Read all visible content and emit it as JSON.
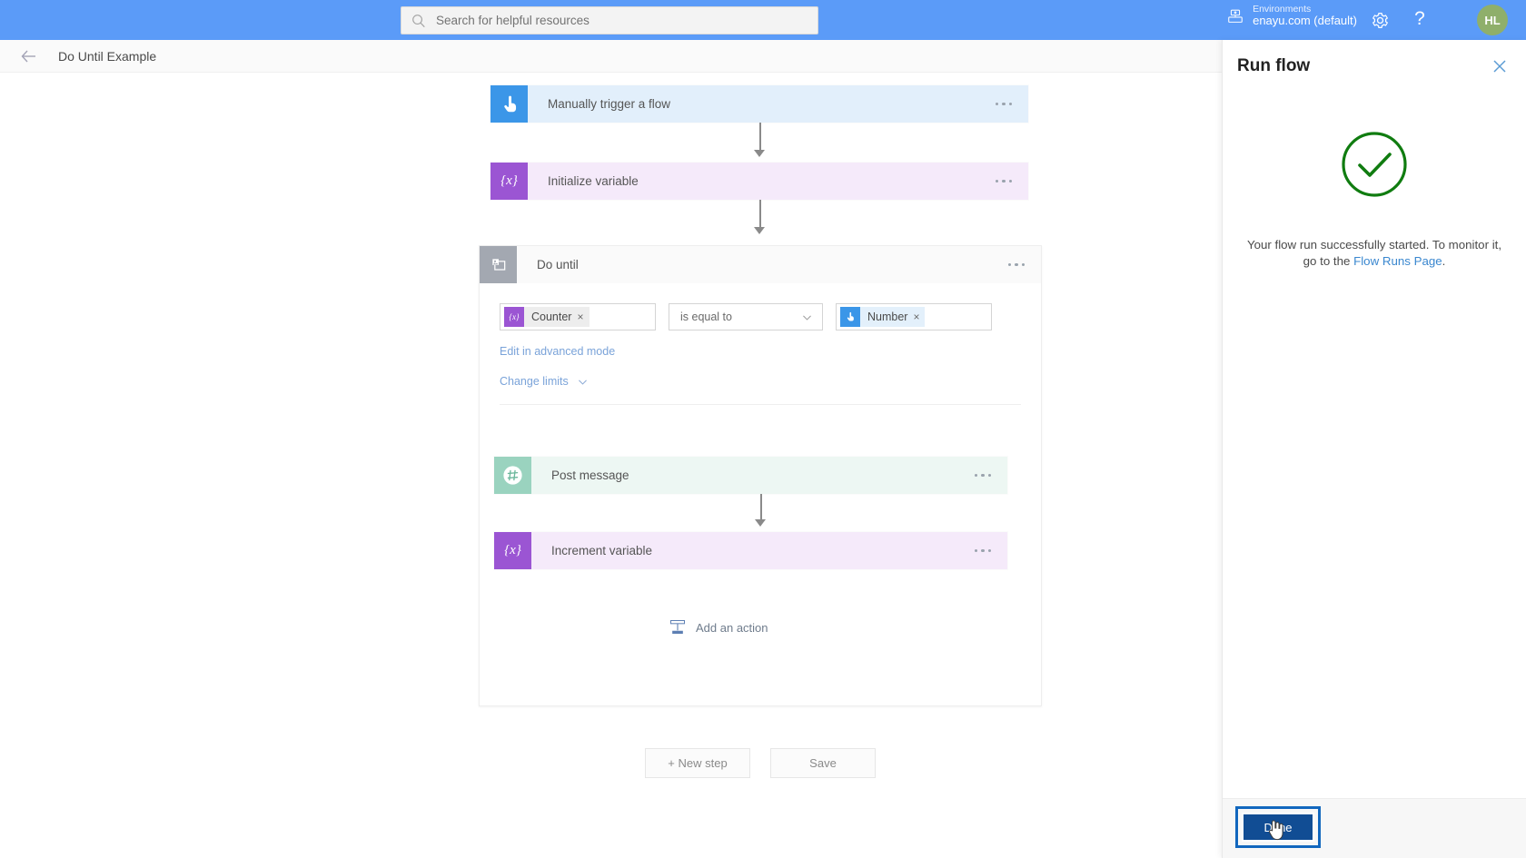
{
  "topbar": {
    "search": {
      "placeholder": "Search for helpful resources",
      "value": "",
      "icon": "search-icon"
    },
    "environment": {
      "label": "Environments",
      "value": "enayu.com (default)",
      "icon": "environment-icon"
    },
    "settings_icon": "gear-icon",
    "help_label": "?",
    "avatar_initials": "HL",
    "accent_color": "#5B9BF8"
  },
  "commandbar": {
    "back_icon": "back-arrow-icon",
    "flow_name": "Do Until Example"
  },
  "designer": {
    "trigger": {
      "title": "Manually trigger a flow",
      "icon": "touch-trigger-icon",
      "color": "#3B96E8",
      "bg": "#E2EFFB",
      "menu": "more-options"
    },
    "initialize": {
      "title": "Initialize variable",
      "icon": "variable-icon",
      "color": "#9B55D3",
      "bg": "#F5EAFA",
      "menu": "more-options"
    },
    "scope": {
      "title": "Do until",
      "icon": "do-until-icon",
      "color": "#A3A8B1",
      "menu": "more-options",
      "condition": {
        "left_token": {
          "text": "Counter",
          "icon": "variable-icon",
          "color": "#9B55D3",
          "remove": "×"
        },
        "operator": {
          "value": "is equal to",
          "chevron": "chevron-down-icon"
        },
        "right_token": {
          "text": "Number",
          "icon": "touch-trigger-icon",
          "color": "#3B96E8",
          "remove": "×"
        }
      },
      "advanced_link": "Edit in advanced mode",
      "limits_link": "Change limits",
      "limits_chevron": "chevron-down-icon",
      "actions": [
        {
          "title": "Post message",
          "icon": "slack-hash-icon",
          "color": "#9AD3BF",
          "bg": "#EDF7F3",
          "menu": "more-options"
        },
        {
          "title": "Increment variable",
          "icon": "variable-icon",
          "color": "#9B55D3",
          "bg": "#F5EAFA",
          "menu": "more-options"
        }
      ],
      "add_action": {
        "label": "Add an action",
        "icon": "add-action-icon"
      }
    },
    "buttons": {
      "new_step": "+ New step",
      "save": "Save"
    }
  },
  "panel": {
    "title": "Run flow",
    "close_icon": "close-icon",
    "status_icon": "success-check-icon",
    "status_color": "#107C10",
    "message_prefix": "Your flow run successfully started. To monitor it, go to the ",
    "message_link": "Flow Runs Page",
    "message_suffix": ".",
    "done_label": "Done",
    "done_color": "#114D94",
    "focus_color": "#1267BE"
  }
}
